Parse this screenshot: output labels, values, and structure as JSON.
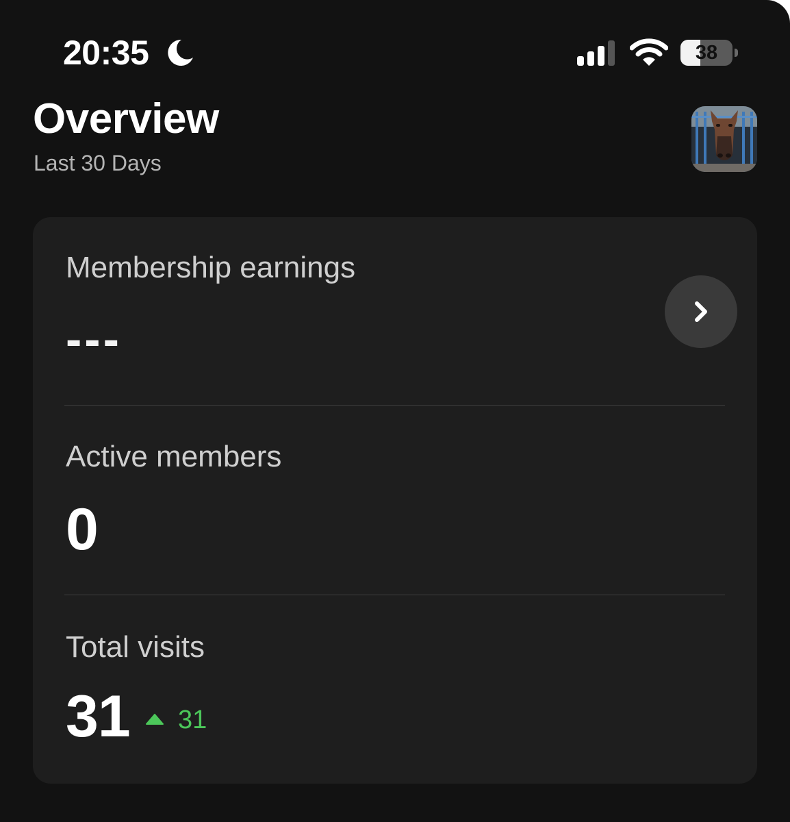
{
  "status_bar": {
    "time": "20:35",
    "battery_level": "38",
    "battery_fraction": 0.38
  },
  "header": {
    "title": "Overview",
    "subtitle": "Last 30 Days"
  },
  "metrics": {
    "earnings": {
      "label": "Membership earnings",
      "value": "---"
    },
    "members": {
      "label": "Active members",
      "value": "0"
    },
    "visits": {
      "label": "Total visits",
      "value": "31",
      "change": "31",
      "change_direction": "up"
    }
  },
  "icons": {
    "moon": "moon-icon",
    "signal": "cellular-signal-icon",
    "wifi": "wifi-icon",
    "battery": "battery-icon",
    "chevron": "chevron-right-icon",
    "trend": "triangle-up-icon"
  },
  "colors": {
    "background": "#121212",
    "card": "#1e1e1e",
    "positive": "#4cc75a"
  }
}
